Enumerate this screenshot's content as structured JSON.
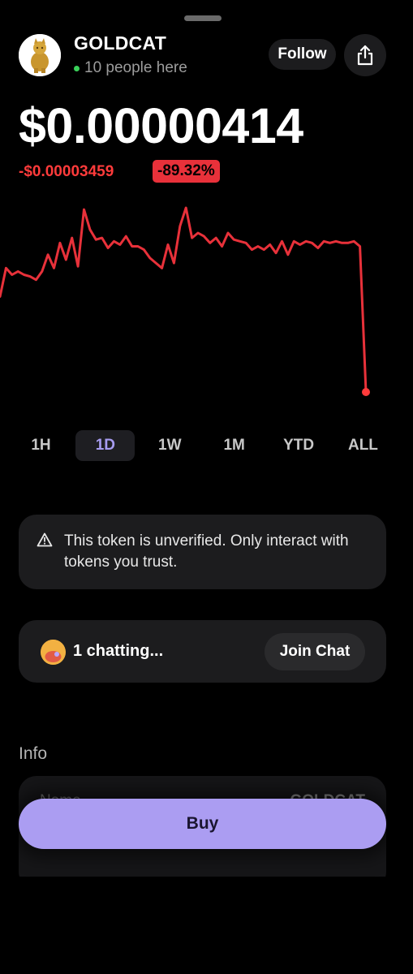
{
  "header": {
    "token_name": "GOLDCAT",
    "presence": "10 people here",
    "follow_label": "Follow"
  },
  "price": {
    "current": "$0.00000414",
    "change_abs": "-$0.00003459",
    "change_pct": "-89.32%"
  },
  "colors": {
    "negative": "#ff3b3b",
    "accent": "#ab9df2",
    "active_range": "#a79cf0",
    "online": "#3ad15a"
  },
  "chart_data": {
    "type": "line",
    "values": [
      40,
      57,
      53,
      55,
      53,
      52,
      50,
      55,
      65,
      57,
      72,
      62,
      75,
      58,
      92,
      80,
      74,
      75,
      69,
      73,
      71,
      76,
      70,
      70,
      68,
      63,
      60,
      57,
      71,
      60,
      82,
      93,
      75,
      78,
      76,
      72,
      75,
      70,
      78,
      74,
      73,
      72,
      68,
      70,
      68,
      71,
      66,
      73,
      65,
      73,
      71,
      73,
      72,
      69,
      73,
      72,
      73,
      72,
      72,
      73,
      70,
      -17
    ],
    "highlight_last": true
  },
  "ranges": [
    {
      "label": "1H",
      "active": false
    },
    {
      "label": "1D",
      "active": true
    },
    {
      "label": "1W",
      "active": false
    },
    {
      "label": "1M",
      "active": false
    },
    {
      "label": "YTD",
      "active": false
    },
    {
      "label": "ALL",
      "active": false
    }
  ],
  "warning": {
    "icon": "warning-icon",
    "text": "This token is unverified. Only interact with tokens you trust."
  },
  "chat": {
    "count_text": "1 chatting...",
    "join_label": "Join Chat"
  },
  "info": {
    "title": "Info",
    "rows": [
      {
        "key": "Name",
        "value": "GOLDCAT"
      }
    ]
  },
  "footer": {
    "buy_label": "Buy"
  }
}
